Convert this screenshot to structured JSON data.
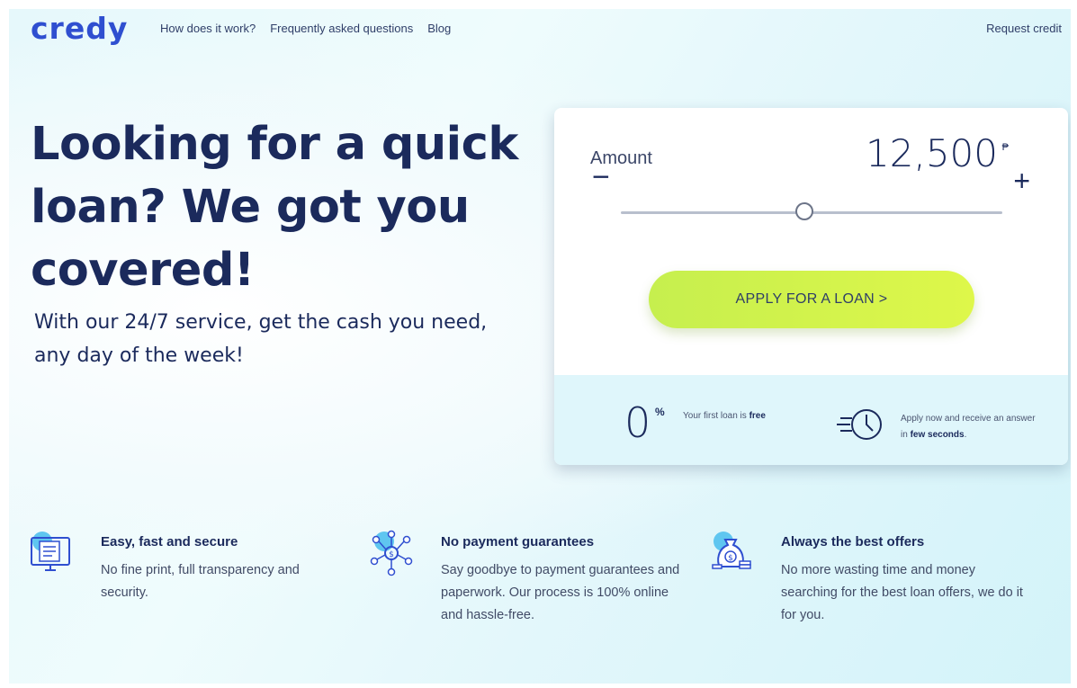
{
  "nav": {
    "logo": "credy",
    "links": [
      "How does it work?",
      "Frequently asked questions",
      "Blog"
    ],
    "request_credit": "Request credit"
  },
  "hero": {
    "title": "Looking for a quick loan? We got you covered!",
    "subtitle": "With our 24/7 service, get the cash you need, any day of the week!"
  },
  "calculator": {
    "amount_label": "Amount",
    "amount_value": "12,500",
    "currency_symbol": "₱",
    "minus_symbol": "−",
    "plus_symbol": "+",
    "slider_fraction": 0.48,
    "apply_label": "APPLY FOR A LOAN   >",
    "rate_value": "0",
    "rate_unit": "%",
    "first_loan_text": "Your first loan is ",
    "first_loan_bold": "free",
    "answer_text": "Apply now and receive an answer in ",
    "answer_bold": "few seconds",
    "answer_end": "."
  },
  "features": [
    {
      "icon": "monitor-document-icon",
      "title": "Easy, fast and secure",
      "desc": "No fine print, full transparency and security."
    },
    {
      "icon": "network-dollar-icon",
      "title": "No payment guarantees",
      "desc": "Say goodbye to payment guarantees and paperwork. Our process is 100% online and hassle-free."
    },
    {
      "icon": "money-bag-icon",
      "title": "Always the best offers",
      "desc": "No more wasting time and money searching for the best loan offers, we do it for you."
    }
  ],
  "colors": {
    "brand_blue": "#2f4fd0",
    "navy_text": "#1b2a5c",
    "cta_green": "#cdf14c",
    "footer_tint": "#dff6fb"
  }
}
